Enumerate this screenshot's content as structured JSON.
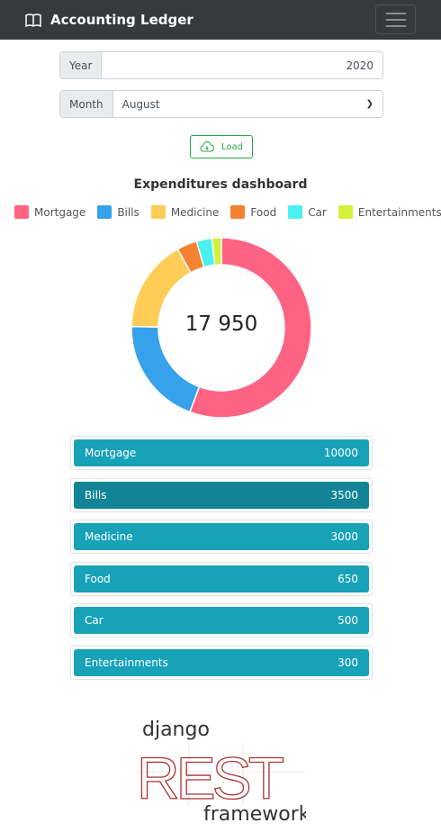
{
  "navbar": {
    "title": "Accounting Ledger",
    "brand_icon": "book-icon",
    "menu_icon": "hamburger-icon"
  },
  "form": {
    "year_label": "Year",
    "year_value": "2020",
    "month_label": "Month",
    "month_value": "August",
    "load_label": "Load",
    "load_icon": "cloud-download-icon"
  },
  "dashboard": {
    "title": "Expenditures dashboard",
    "total": "17 950"
  },
  "chart_data": {
    "type": "pie",
    "variant": "doughnut",
    "categories": [
      "Mortgage",
      "Bills",
      "Medicine",
      "Food",
      "Car",
      "Entertainments"
    ],
    "values": [
      10000,
      3500,
      3000,
      650,
      500,
      300
    ],
    "colors": [
      "#ff6384",
      "#36a2eb",
      "#ffcd56",
      "#f58231",
      "#4bf0f0",
      "#d4f03a"
    ],
    "legend": "top"
  },
  "items": [
    {
      "label": "Mortgage",
      "value": "10000"
    },
    {
      "label": "Bills",
      "value": "3500"
    },
    {
      "label": "Medicine",
      "value": "3000"
    },
    {
      "label": "Food",
      "value": "650"
    },
    {
      "label": "Car",
      "value": "500"
    },
    {
      "label": "Entertainments",
      "value": "300"
    }
  ],
  "footer": {
    "logo_text": "django REST framework"
  }
}
